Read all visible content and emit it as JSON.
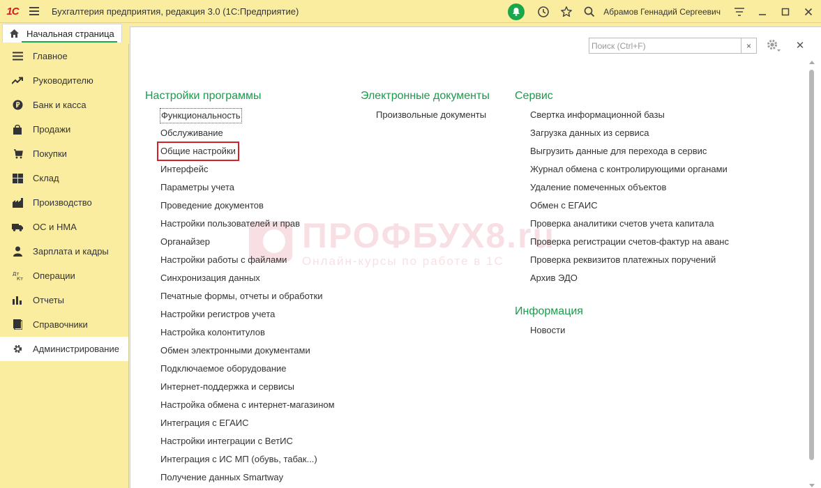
{
  "app": {
    "logo_text": "1С",
    "title": "Бухгалтерия предприятия, редакция 3.0  (1С:Предприятие)",
    "user": "Абрамов Геннадий Сергеевич"
  },
  "tabs": {
    "home_label": "Начальная страница"
  },
  "sidebar": {
    "items": [
      {
        "label": "Главное",
        "icon": "menu-icon"
      },
      {
        "label": "Руководителю",
        "icon": "trend-icon"
      },
      {
        "label": "Банк и касса",
        "icon": "ruble-coin-icon"
      },
      {
        "label": "Продажи",
        "icon": "shopping-bag-icon"
      },
      {
        "label": "Покупки",
        "icon": "cart-icon"
      },
      {
        "label": "Склад",
        "icon": "warehouse-icon"
      },
      {
        "label": "Производство",
        "icon": "factory-icon"
      },
      {
        "label": "ОС и НМА",
        "icon": "truck-icon"
      },
      {
        "label": "Зарплата и кадры",
        "icon": "person-icon"
      },
      {
        "label": "Операции",
        "icon": "dt-kt-icon"
      },
      {
        "label": "Отчеты",
        "icon": "bar-chart-icon"
      },
      {
        "label": "Справочники",
        "icon": "book-icon"
      },
      {
        "label": "Администрирование",
        "icon": "gear-icon",
        "active": true
      }
    ]
  },
  "search": {
    "placeholder": "Поиск (Ctrl+F)",
    "clear_label": "×"
  },
  "sections": {
    "settings": {
      "title": "Настройки программы",
      "links": [
        "Функциональность",
        "Обслуживание",
        "Общие настройки",
        "Интерфейс",
        "Параметры учета",
        "Проведение документов",
        "Настройки пользователей и прав",
        "Органайзер",
        "Настройки работы с файлами",
        "Синхронизация данных",
        "Печатные формы, отчеты и обработки",
        "Настройки регистров учета",
        "Настройка колонтитулов",
        "Обмен электронными документами",
        "Подключаемое оборудование",
        "Интернет-поддержка и сервисы",
        "Настройка обмена с интернет-магазином",
        "Интеграция с ЕГАИС",
        "Настройки интеграции с ВетИС",
        "Интеграция с ИС МП (обувь, табак...)",
        "Получение данных Smartway"
      ]
    },
    "edocs": {
      "title": "Электронные документы",
      "links": [
        "Произвольные документы"
      ]
    },
    "service": {
      "title": "Сервис",
      "links": [
        "Свертка информационной базы",
        "Загрузка данных из сервиса",
        "Выгрузить данные для перехода в сервис",
        "Журнал обмена с контролирующими органами",
        "Удаление помеченных объектов",
        "Обмен с ЕГАИС",
        "Проверка аналитики счетов учета капитала",
        "Проверка регистрации счетов-фактур на аванс",
        "Проверка реквизитов платежных поручений",
        "Архив ЭДО"
      ]
    },
    "info": {
      "title": "Информация",
      "links": [
        "Новости"
      ]
    }
  },
  "watermark": {
    "big": "ПРОФБУХ8.ru",
    "small": "Онлайн-курсы по работе в 1С"
  },
  "colors": {
    "panel": "#fbeda0",
    "section_title": "#1a9b4b",
    "highlight": "#d6202a",
    "notification": "#1aa64a"
  }
}
